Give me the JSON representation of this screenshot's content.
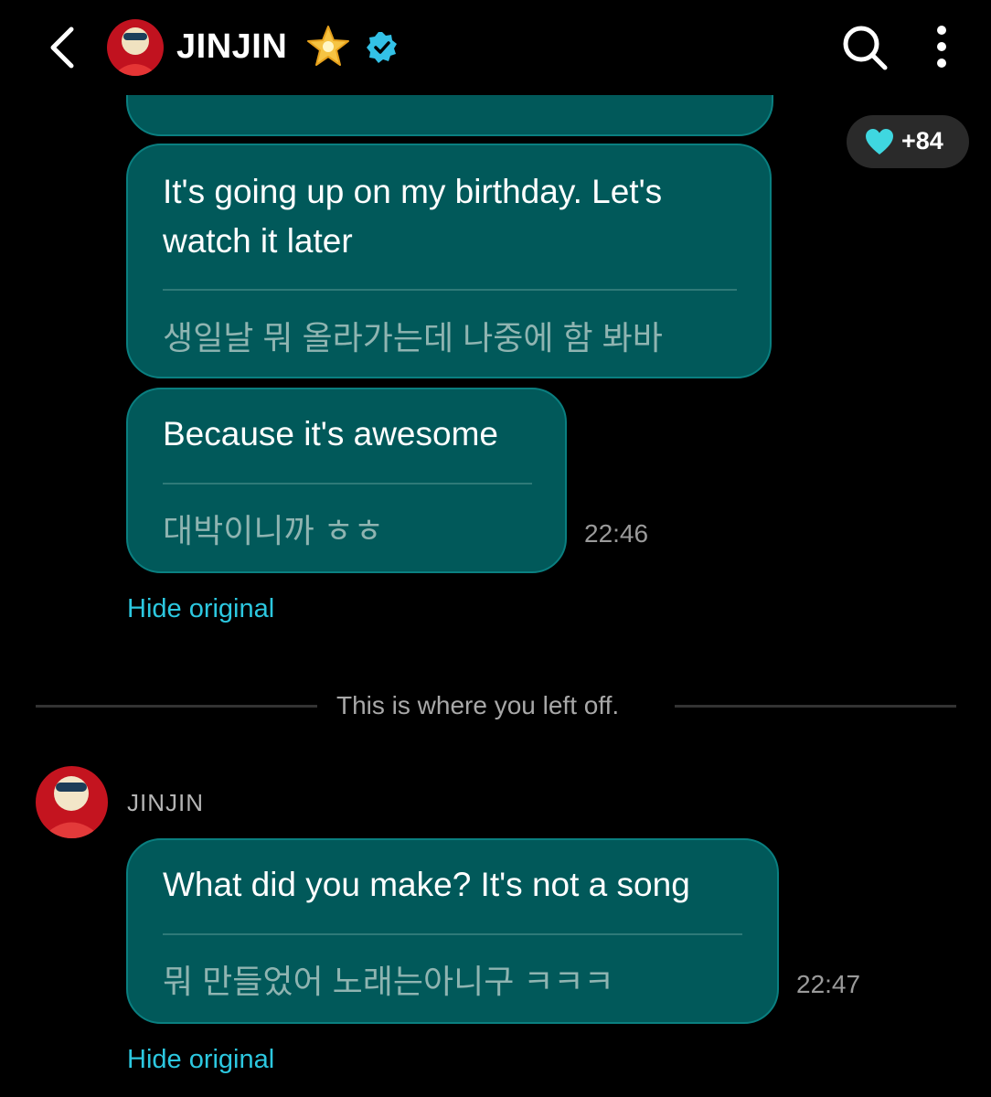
{
  "header": {
    "title": "JINJIN",
    "back_icon": "chevron-left-icon",
    "star_icon": "glowing-star-emoji",
    "verified_icon": "verified-badge-icon",
    "search_icon": "search-icon",
    "more_icon": "more-vertical-icon"
  },
  "reaction": {
    "icon": "heart-icon",
    "count": "+84",
    "color": "#3fd7e0"
  },
  "messages": [
    {
      "en": [
        "It's going up on my birthday. Let's",
        "watch it later"
      ],
      "ko": "생일날 뭐 올라가는데 나중에 함 봐바"
    },
    {
      "en": [
        "Because it's awesome"
      ],
      "ko": "대박이니까 ㅎㅎ",
      "time": "22:46",
      "hide_label": "Hide original"
    },
    {
      "sender": "JINJIN",
      "en": [
        "What did you make? It's not a song"
      ],
      "ko": "뭐 만들었어 노래는아니구 ㅋㅋㅋ",
      "time": "22:47",
      "hide_label": "Hide original"
    }
  ],
  "divider_text": "This is where you left off.",
  "colors": {
    "bubble": "#01595a",
    "accent": "#2cc8e0",
    "background": "#000000"
  }
}
